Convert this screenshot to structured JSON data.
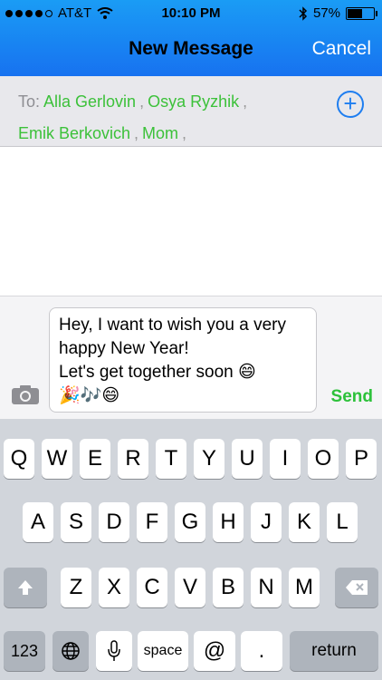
{
  "status_bar": {
    "carrier": "AT&T",
    "time": "10:10 PM",
    "battery": "57%",
    "battery_level": 0.57
  },
  "nav": {
    "title": "New Message",
    "cancel_label": "Cancel"
  },
  "recipients": {
    "to_label": "To:",
    "names": [
      "Alla Gerlovin",
      "Osya Ryzhik",
      "Emik Berkovich",
      "Mom"
    ],
    "separator": ","
  },
  "compose": {
    "message": "Hey, I want to wish you a very happy New Year!\nLet's get together soon 😄\n🎉🎶😄",
    "send_label": "Send"
  },
  "keyboard": {
    "row1": [
      "Q",
      "W",
      "E",
      "R",
      "T",
      "Y",
      "U",
      "I",
      "O",
      "P"
    ],
    "row2": [
      "A",
      "S",
      "D",
      "F",
      "G",
      "H",
      "J",
      "K",
      "L"
    ],
    "row3": [
      "Z",
      "X",
      "C",
      "V",
      "B",
      "N",
      "M"
    ],
    "numbers_label": "123",
    "space_label": "space",
    "at_label": "@",
    "dot_label": ".",
    "return_label": "return"
  }
}
